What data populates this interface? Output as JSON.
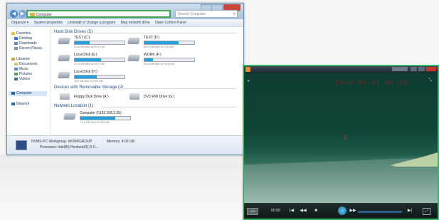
{
  "explorer": {
    "address_text": "Computer",
    "search_placeholder": "Search Computer",
    "toolbar": {
      "organize": "Organize ▾",
      "system_properties": "System properties",
      "uninstall": "Uninstall or change a program",
      "map_network": "Map network drive",
      "control_panel": "Open Control Panel"
    },
    "nav": {
      "favorites": "Favorites",
      "desktop": "Desktop",
      "downloads": "Downloads",
      "recent": "Recent Places",
      "libraries": "Libraries",
      "documents": "Documents",
      "music": "Music",
      "pictures": "Pictures",
      "videos": "Videos",
      "computer": "Computer",
      "network": "Network"
    },
    "sections": {
      "hard_disks": "Hard Disk Drives (5)",
      "removable": "Devices with Removable Storage (2)",
      "network_location": "Network Location (1)"
    },
    "drives": [
      {
        "name": "TEST (C:)",
        "free": "20.6 GB free of 29.2 GB",
        "used_pct": 30
      },
      {
        "name": "TEST (D:)",
        "free": "38.9 GB free of 120 GB",
        "used_pct": 68
      },
      {
        "name": "Local Disk (E:)",
        "free": "21.6 GB free of 46.2 GB",
        "used_pct": 53
      },
      {
        "name": "WORK (F:)",
        "free": "63.8 GB free of 76.6 GB",
        "used_pct": 17
      },
      {
        "name": "Local Disk (H:)",
        "free": "129 GB free of 232 GB",
        "used_pct": 44
      }
    ],
    "removable": [
      {
        "name": "Floppy Disk Drive (A:)"
      },
      {
        "name": "DVD RW Drive (G:)"
      }
    ],
    "network_drive": {
      "name": "Computer (\\\\192.168.2.35)",
      "free": "71.1 GB free of 233 GB",
      "used_pct": 70
    },
    "details": {
      "pc_name": "NVMS-PC",
      "workgroup_label": "Workgroup:",
      "workgroup_value": "WORKGROUP",
      "memory_label": "Memory:",
      "memory_value": "4.00 GB",
      "processor_label": "Processor:",
      "processor_value": "Intel(R) Pentium(R) D C..."
    }
  },
  "player": {
    "timestamp": "2010-01-01 00:00",
    "channel": "2",
    "volume_label": "VOL",
    "time": "00:00",
    "controls": [
      "|◀",
      "◀◀",
      "■",
      "▶",
      "▶▶",
      "▶|"
    ],
    "fullscreen": "⤢"
  }
}
